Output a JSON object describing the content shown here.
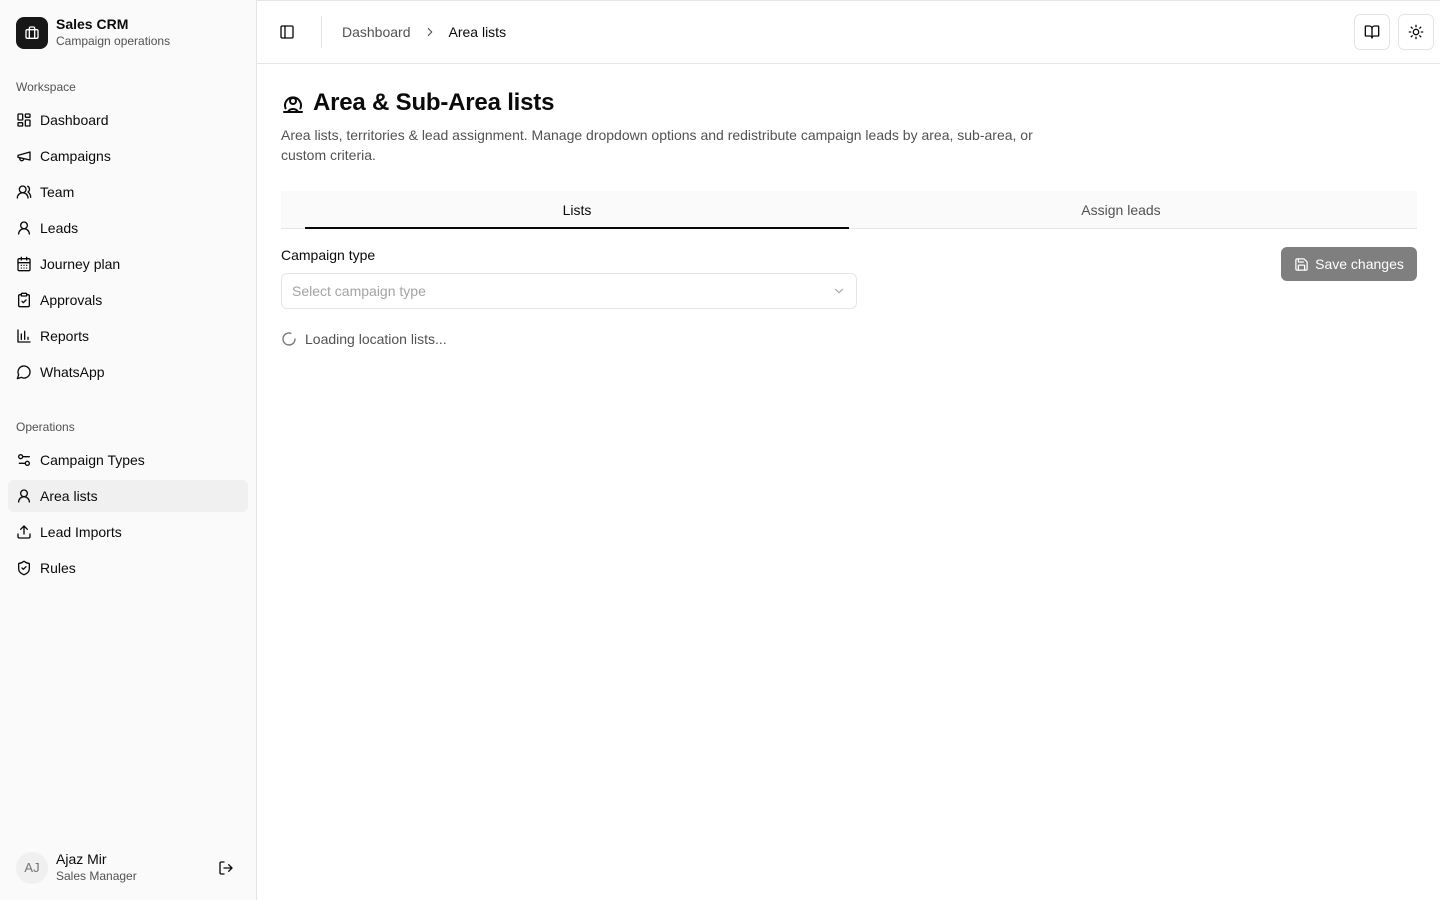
{
  "brand": {
    "title": "Sales CRM",
    "subtitle": "Campaign operations"
  },
  "sidebar": {
    "workspace_label": "Workspace",
    "workspace_items": [
      {
        "label": "Dashboard",
        "icon": "dashboard-icon"
      },
      {
        "label": "Campaigns",
        "icon": "megaphone-icon"
      },
      {
        "label": "Team",
        "icon": "users-icon"
      },
      {
        "label": "Leads",
        "icon": "user-icon"
      },
      {
        "label": "Journey plan",
        "icon": "calendar-icon"
      },
      {
        "label": "Approvals",
        "icon": "clipboard-check-icon"
      },
      {
        "label": "Reports",
        "icon": "bar-chart-icon"
      },
      {
        "label": "WhatsApp",
        "icon": "message-circle-icon"
      }
    ],
    "operations_label": "Operations",
    "operations_items": [
      {
        "label": "Campaign Types",
        "icon": "sliders-icon"
      },
      {
        "label": "Area lists",
        "icon": "map-pin-user-icon",
        "active": true
      },
      {
        "label": "Lead Imports",
        "icon": "upload-icon"
      },
      {
        "label": "Rules",
        "icon": "shield-check-icon"
      }
    ]
  },
  "user": {
    "initials": "AJ",
    "name": "Ajaz Mir",
    "role": "Sales Manager"
  },
  "breadcrumb": {
    "parent": "Dashboard",
    "current": "Area lists"
  },
  "page": {
    "title": "Area & Sub-Area lists",
    "description": "Area lists, territories & lead assignment. Manage dropdown options and redistribute campaign leads by area, sub-area, or custom criteria."
  },
  "tabs": [
    {
      "label": "Lists",
      "active": true
    },
    {
      "label": "Assign leads",
      "active": false
    }
  ],
  "form": {
    "campaign_type_label": "Campaign type",
    "campaign_type_placeholder": "Select campaign type",
    "save_label": "Save changes"
  },
  "status": {
    "loading_text": "Loading location lists..."
  }
}
